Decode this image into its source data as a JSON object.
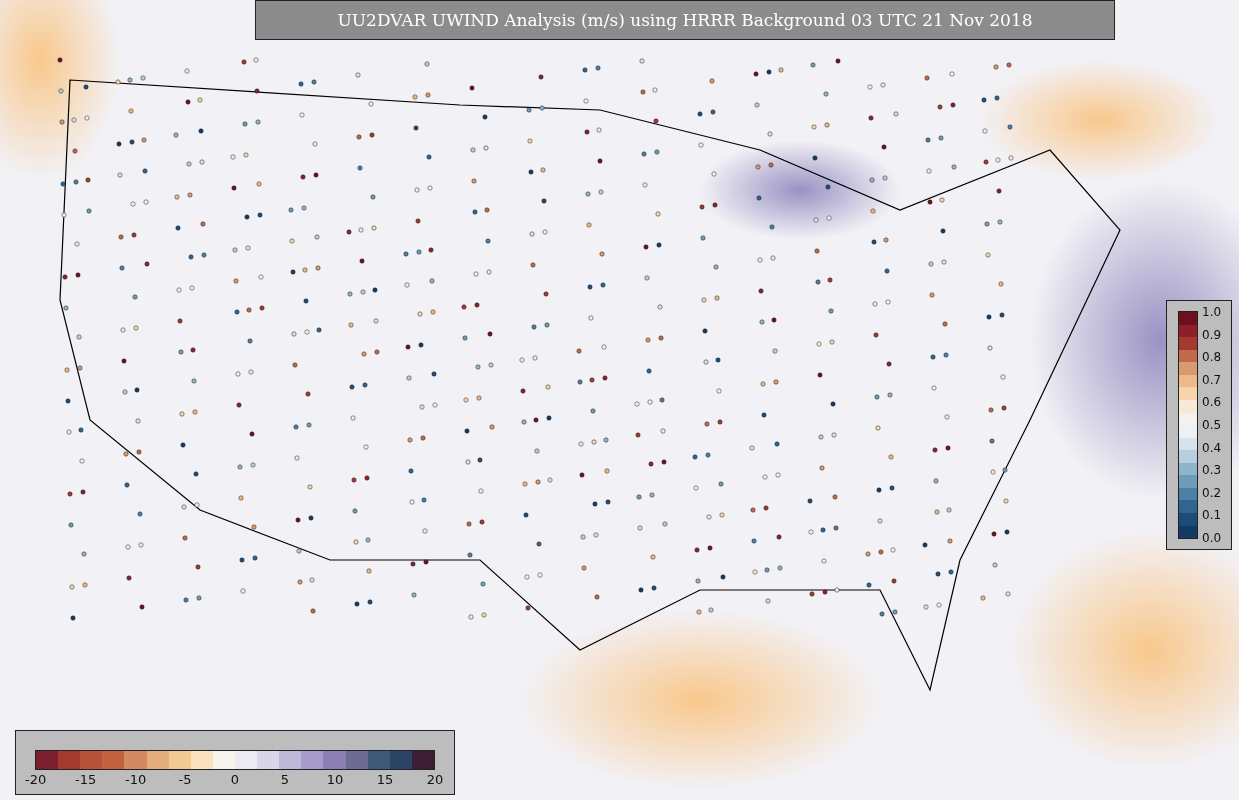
{
  "title": "UU2DVAR UWIND Analysis (m/s) using HRRR Background 03 UTC 21 Nov 2018",
  "observation_colorbar": {
    "labels": [
      "1.0",
      "0.9",
      "0.8",
      "0.7",
      "0.6",
      "0.5",
      "0.4",
      "0.3",
      "0.2",
      "0.1",
      "0.0"
    ]
  },
  "analysis_colorbar": {
    "labels": [
      "-20",
      "-15",
      "-10",
      "-5",
      "0",
      "5",
      "10",
      "15",
      "20"
    ]
  }
}
